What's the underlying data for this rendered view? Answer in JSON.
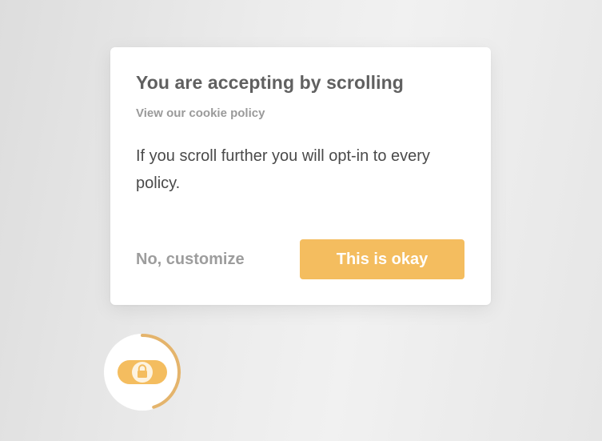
{
  "dialog": {
    "title": "You are accepting by scrolling",
    "policy_link": "View our cookie policy",
    "message": "If you scroll further you will opt-in to every policy.",
    "secondary_button": "No, customize",
    "primary_button": "This is okay"
  },
  "consent_widget": {
    "icon": "lock-icon",
    "scroll_progress": 0.45
  },
  "colors": {
    "accent": "#f4bd5f",
    "progress_ring": "#e4b46c",
    "title_text": "#606060",
    "body_text": "#4a4a4a",
    "muted_text": "#9a9a9a",
    "dialog_bg": "#ffffff"
  }
}
